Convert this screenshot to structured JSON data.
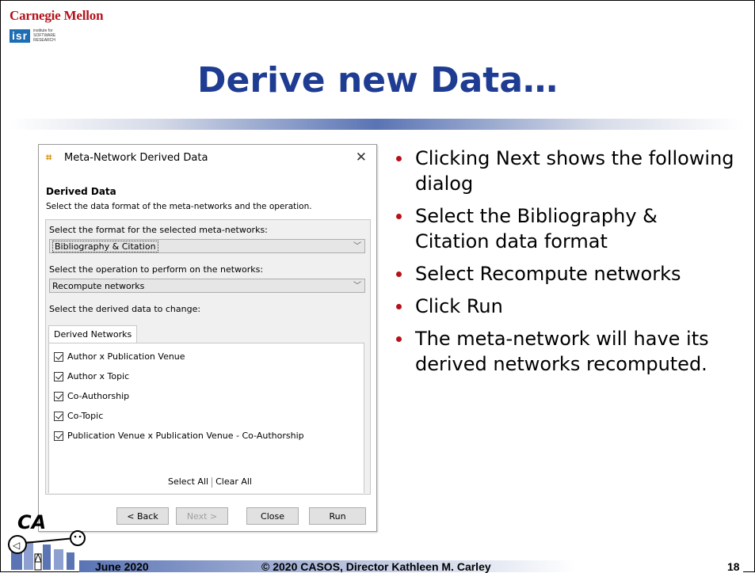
{
  "header": {
    "university": "Carnegie Mellon",
    "isr_abbrev": "isr",
    "isr_text_1": "institute for",
    "isr_text_2": "SOFTWARE",
    "isr_text_3": "RESEARCH",
    "title": "Derive new Data…"
  },
  "dialog": {
    "title": "Meta-Network Derived Data",
    "icon": "meta-network-icon",
    "heading": "Derived Data",
    "description": "Select the data format of the meta-networks and the operation.",
    "format_label": "Select the format for the selected meta-networks:",
    "format_value": "Bibliography & Citation",
    "operation_label": "Select the operation to perform on the networks:",
    "operation_value": "Recompute networks",
    "derived_label": "Select the derived data to change:",
    "tab_label": "Derived Networks",
    "items": [
      "Author x Publication Venue",
      "Author x Topic",
      "Co-Authorship",
      "Co-Topic",
      "Publication Venue x Publication Venue - Co-Authorship"
    ],
    "select_all": "Select All",
    "clear_all": "Clear All",
    "buttons": {
      "back": "< Back",
      "next": "Next >",
      "close": "Close",
      "run": "Run"
    }
  },
  "bullets": [
    "Clicking Next shows the following dialog",
    "Select the Bibliography & Citation data format",
    "Select Recompute networks",
    "Click Run",
    "The meta-network will have its derived networks recomputed."
  ],
  "footer": {
    "date": "June 2020",
    "copyright": "© 2020 CASOS, Director Kathleen M. Carley",
    "page": "18"
  },
  "colors": {
    "title": "#1f3c93",
    "cmu_red": "#b5121b",
    "bullet": "#b5121b"
  }
}
